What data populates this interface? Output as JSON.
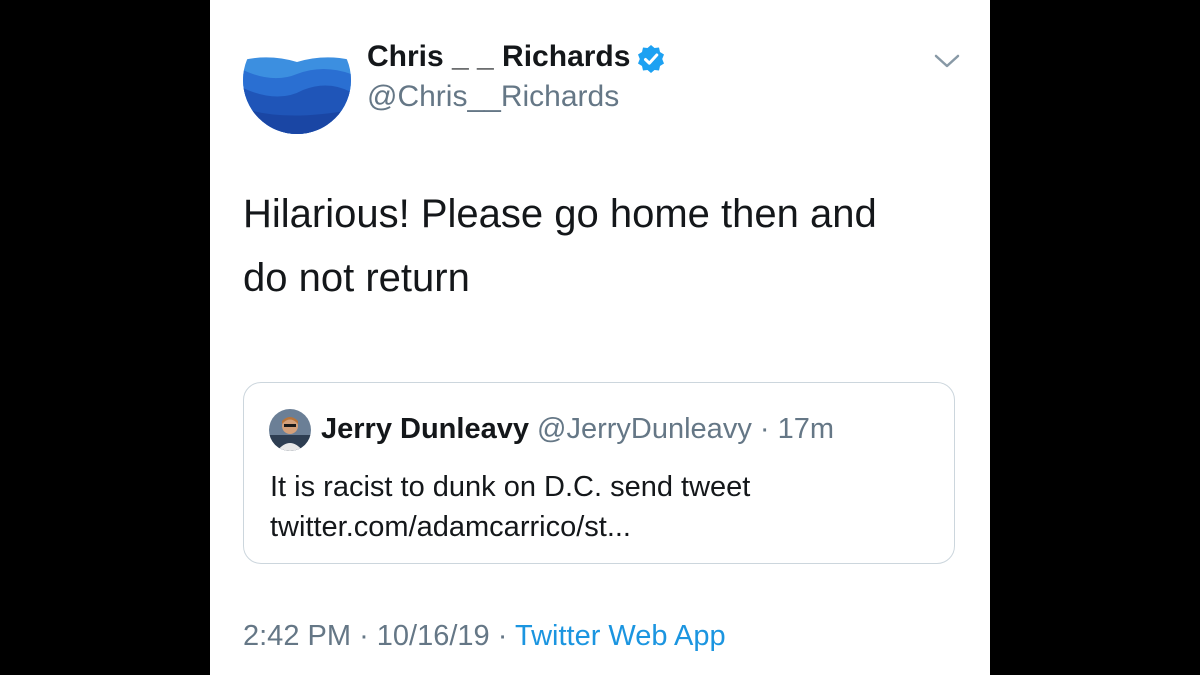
{
  "user": {
    "display_name": "Chris _ _ Richards",
    "handle": "@Chris__Richards",
    "verified": true
  },
  "tweet": {
    "text_line1": "Hilarious! Please go home then and",
    "text_line2": "do not return"
  },
  "quoted_tweet": {
    "display_name": "Jerry Dunleavy",
    "handle": "@JerryDunleavy",
    "separator": "·",
    "time": "17m",
    "text_line1": "It is racist to dunk on D.C. send tweet",
    "text_line2": "twitter.com/adamcarrico/st..."
  },
  "footer": {
    "time": "2:42 PM",
    "date": "10/16/19",
    "separator": "·",
    "app": "Twitter Web App"
  },
  "colors": {
    "link_blue": "#1b95e0",
    "verified_blue": "#1da1f2",
    "secondary_text": "#657786",
    "border": "#ccd6dd"
  },
  "icons": {
    "verified": "verified-badge-icon",
    "menu": "chevron-down-icon"
  }
}
